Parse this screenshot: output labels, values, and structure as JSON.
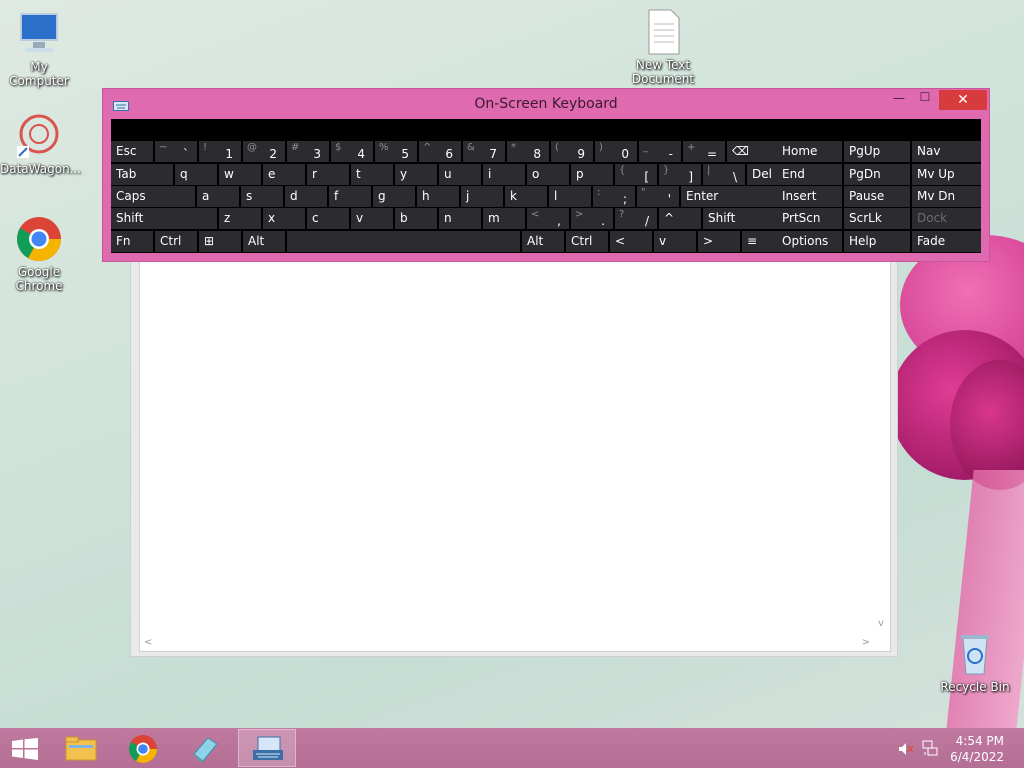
{
  "desktop": {
    "icons": [
      {
        "label": "My Computer",
        "icon": "computer-icon"
      },
      {
        "label": "DataWagon...",
        "icon": "datawagon-icon"
      },
      {
        "label": "Google Chrome",
        "icon": "chrome-icon"
      },
      {
        "label": "New Text Document",
        "icon": "text-document-icon"
      },
      {
        "label": "Recycle Bin",
        "icon": "recycle-bin-icon"
      }
    ]
  },
  "osk": {
    "title": "On-Screen Keyboard",
    "minimize": "—",
    "maximize": "☐",
    "close": "✕",
    "rows": [
      [
        {
          "main": "Esc"
        },
        {
          "sh": "~",
          "low": "`"
        },
        {
          "sh": "!",
          "low": "1"
        },
        {
          "sh": "@",
          "low": "2"
        },
        {
          "sh": "#",
          "low": "3"
        },
        {
          "sh": "$",
          "low": "4"
        },
        {
          "sh": "%",
          "low": "5"
        },
        {
          "sh": "^",
          "low": "6"
        },
        {
          "sh": "&",
          "low": "7"
        },
        {
          "sh": "*",
          "low": "8"
        },
        {
          "sh": "(",
          "low": "9"
        },
        {
          "sh": ")",
          "low": "0"
        },
        {
          "sh": "_",
          "low": "-"
        },
        {
          "sh": "+",
          "low": "="
        },
        {
          "main": "⌫"
        }
      ],
      [
        {
          "main": "Tab"
        },
        {
          "main": "q"
        },
        {
          "main": "w"
        },
        {
          "main": "e"
        },
        {
          "main": "r"
        },
        {
          "main": "t"
        },
        {
          "main": "y"
        },
        {
          "main": "u"
        },
        {
          "main": "i"
        },
        {
          "main": "o"
        },
        {
          "main": "p"
        },
        {
          "sh": "{",
          "low": "["
        },
        {
          "sh": "}",
          "low": "]"
        },
        {
          "sh": "|",
          "low": "\\"
        },
        {
          "main": "Del"
        }
      ],
      [
        {
          "main": "Caps"
        },
        {
          "main": "a"
        },
        {
          "main": "s"
        },
        {
          "main": "d"
        },
        {
          "main": "f"
        },
        {
          "main": "g"
        },
        {
          "main": "h"
        },
        {
          "main": "j"
        },
        {
          "main": "k"
        },
        {
          "main": "l"
        },
        {
          "sh": ":",
          "low": ";"
        },
        {
          "sh": "\"",
          "low": "'"
        },
        {
          "main": "Enter"
        }
      ],
      [
        {
          "main": "Shift"
        },
        {
          "main": "z"
        },
        {
          "main": "x"
        },
        {
          "main": "c"
        },
        {
          "main": "v"
        },
        {
          "main": "b"
        },
        {
          "main": "n"
        },
        {
          "main": "m"
        },
        {
          "sh": "<",
          "low": ","
        },
        {
          "sh": ">",
          "low": "."
        },
        {
          "sh": "?",
          "low": "/"
        },
        {
          "main": "^"
        },
        {
          "main": "Shift"
        }
      ],
      [
        {
          "main": "Fn"
        },
        {
          "main": "Ctrl"
        },
        {
          "main": "⊞"
        },
        {
          "main": "Alt"
        },
        {
          "main": ""
        },
        {
          "main": "Alt"
        },
        {
          "main": "Ctrl"
        },
        {
          "main": "<"
        },
        {
          "main": "v"
        },
        {
          "main": ">"
        },
        {
          "main": "≡"
        }
      ]
    ],
    "nav_rows": [
      [
        "Home",
        "PgUp",
        "Nav"
      ],
      [
        "End",
        "PgDn",
        "Mv Up"
      ],
      [
        "Insert",
        "Pause",
        "Mv Dn"
      ],
      [
        "PrtScn",
        "ScrLk",
        "Dock"
      ],
      [
        "Options",
        "Help",
        "Fade"
      ]
    ]
  },
  "notepad": {
    "scroll_up": "^",
    "scroll_down": "v",
    "scroll_left": "<",
    "scroll_right": ">"
  },
  "taskbar": {
    "apps": [
      {
        "icon": "start-icon"
      },
      {
        "icon": "file-explorer-icon"
      },
      {
        "icon": "chrome-icon"
      },
      {
        "icon": "notepad-icon"
      },
      {
        "icon": "on-screen-keyboard-icon"
      }
    ],
    "time": "4:54 PM",
    "date": "6/4/2022"
  }
}
